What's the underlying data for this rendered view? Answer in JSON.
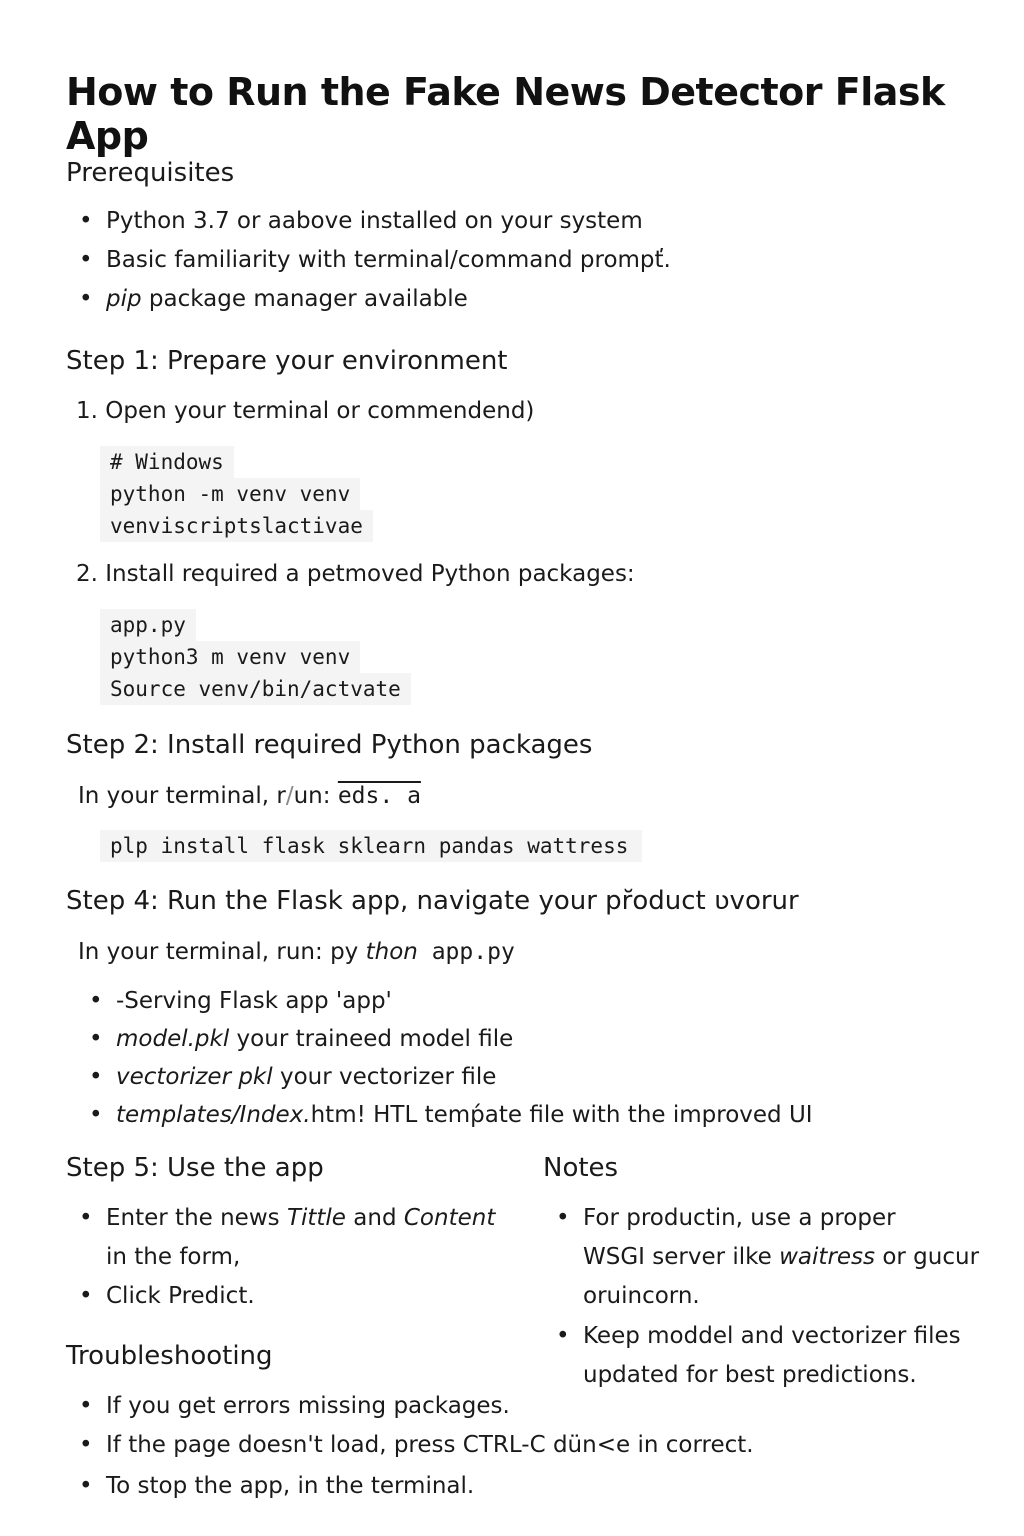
{
  "title": "How to Run the Fake News Detector Flask App",
  "prereq": {
    "heading": "Prerequisites",
    "items": [
      "Python 3.7 or aabove installed on your system",
      "Basic familiarity with terminal/command prompť.",
      {
        "em": "pip",
        "rest": " package manager available"
      }
    ]
  },
  "step1": {
    "heading": "Step 1: Prepare your environment",
    "item1": "1. Open your terminal or commendend)",
    "code1": [
      "# Windows",
      "python -m venv venv",
      "venviscriptslactivae"
    ],
    "item2": "2. Install required a petmoved Python packages:",
    "code2": [
      "app.py",
      "python3 m venv venv",
      "Source venv/bin/actvate"
    ]
  },
  "step2": {
    "heading": "Step 2: Install required Python packages",
    "run_prefix": "In your terminal, r",
    "run_mid": "un: ",
    "run_suffix": "eds. a",
    "code": "plp install flask sklearn pandas wattress"
  },
  "step4": {
    "heading": "Step 4: Run the Flask app, navigate your pr̆oduct ʋvorur",
    "run_prefix": "In your terminal, run:  ",
    "run_cmd_a": "py",
    "run_cmd_b": " thon",
    "run_cmd_c": " app.py",
    "items": [
      {
        "em": "",
        "rest": "-Serving Flask app 'app'"
      },
      {
        "em": "model.pkl",
        "rest": "  your traineed model file"
      },
      {
        "em": "vectorizer pkl",
        "rest": "  your vectorizer file"
      },
      {
        "em": "templates/Index.",
        "mid": "htm!",
        "rest": " HTL temṕate file with the improved UI"
      }
    ]
  },
  "step5": {
    "heading": "Step 5: Use the app",
    "item1_pre": "Enter the news  ",
    "item1_em1": "Tittle",
    "item1_mid": " and ",
    "item1_em2": "Content",
    "item1_line2": "in the form,",
    "item2": "Click Predict."
  },
  "notes": {
    "heading": "Notes",
    "item1_line1": "For productin, use a proper",
    "item1_line2_pre": "WSGI server ilke ",
    "item1_line2_em": "waitress",
    "item1_line2_post": " or gucur",
    "item1_line3": "oruincorn.",
    "item2_line1": "Keep moddel and vectorizer files",
    "item2_line2": "updated for best predictions."
  },
  "trouble": {
    "heading": "Troubleshooting",
    "items": [
      "If you get errors   missing packages.",
      "If the page doesn't load, press CTRL-C dün<e in correct.",
      "To stop the app, in the terminal."
    ]
  }
}
